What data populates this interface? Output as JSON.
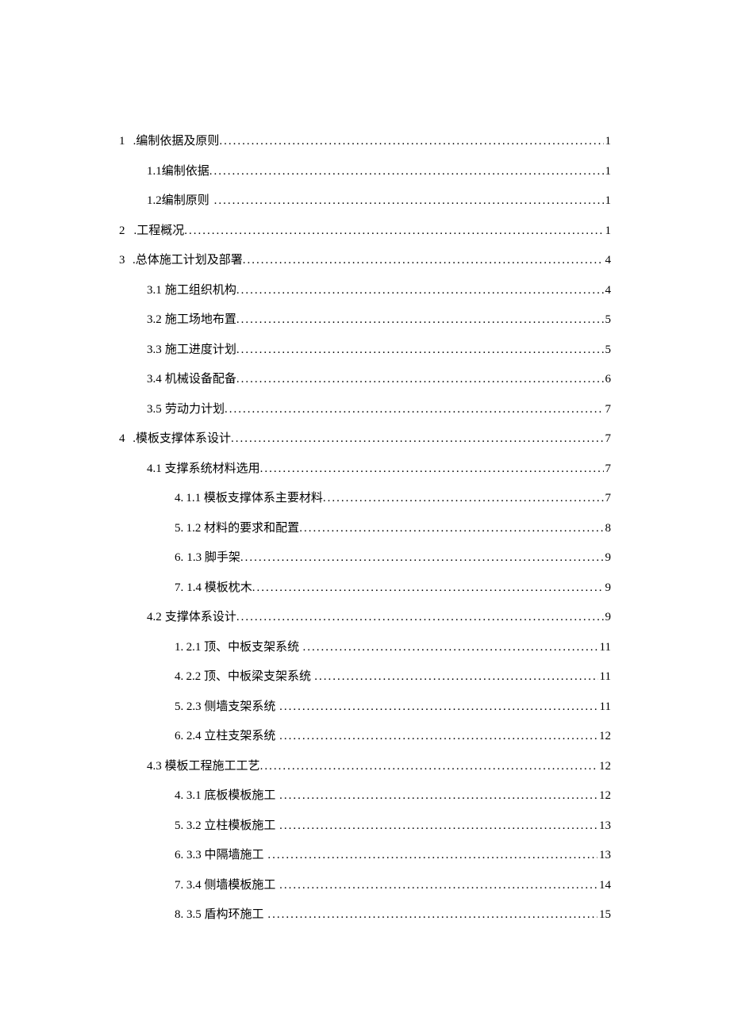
{
  "toc": [
    {
      "level": 1,
      "num": "1",
      "sep": "wide",
      "title": ".编制依据及原则",
      "page": "1"
    },
    {
      "level": 2,
      "num": "1.1",
      "sep": "none",
      "title": "编制依据",
      "page": "1"
    },
    {
      "level": 2,
      "num": "1.2",
      "sep": "none",
      "title": "编制原则",
      "titleGap": true,
      "page": "1"
    },
    {
      "level": 1,
      "num": "2",
      "sep": "wide",
      "title": ".工程概况",
      "page": "1"
    },
    {
      "level": 1,
      "num": "3",
      "sep": "wide",
      "title": ".总体施工计划及部署",
      "page": "4"
    },
    {
      "level": 2,
      "num": "3.1",
      "sep": "narrow",
      "title": " 施工组织机构",
      "page": "4"
    },
    {
      "level": 2,
      "num": "3.2",
      "sep": "narrow",
      "title": " 施工场地布置",
      "page": "5"
    },
    {
      "level": 2,
      "num": "3.3",
      "sep": "narrow",
      "title": " 施工进度计划",
      "page": "5"
    },
    {
      "level": 2,
      "num": "3.4",
      "sep": "narrow",
      "title": " 机械设备配备",
      "page": "6"
    },
    {
      "level": 2,
      "num": "3.5",
      "sep": "narrow",
      "title": " 劳动力计划",
      "page": "7"
    },
    {
      "level": 1,
      "num": "4",
      "sep": "wide",
      "title": ".模板支撑体系设计",
      "page": "7"
    },
    {
      "level": 2,
      "num": "4.1",
      "sep": "narrow",
      "title": " 支撑系统材料选用",
      "page": "7"
    },
    {
      "level": 3,
      "num": "4.",
      "sep": "narrow",
      "title": " 1.1 模板支撑体系主要材料",
      "page": "7"
    },
    {
      "level": 3,
      "num": "5.",
      "sep": "narrow",
      "title": " 1.2 材料的要求和配置",
      "page": "8"
    },
    {
      "level": 3,
      "num": "6.",
      "sep": "narrow",
      "title": " 1.3 脚手架",
      "page": "9"
    },
    {
      "level": 3,
      "num": "7.",
      "sep": "narrow",
      "title": " 1.4 模板枕木",
      "page": "9"
    },
    {
      "level": 2,
      "num": "4.2",
      "sep": "narrow",
      "title": " 支撑体系设计",
      "page": "9"
    },
    {
      "level": 3,
      "num": "1.",
      "sep": "narrow",
      "title": " 2.1 顶、中板支架系统",
      "titleGap": true,
      "page": "11"
    },
    {
      "level": 3,
      "num": "4.",
      "sep": "narrow",
      "title": " 2.2 顶、中板梁支架系统",
      "titleGap": true,
      "page": "11"
    },
    {
      "level": 3,
      "num": "5.",
      "sep": "narrow",
      "title": " 2.3 侧墙支架系统",
      "titleGap": true,
      "page": "11"
    },
    {
      "level": 3,
      "num": "6.",
      "sep": "narrow",
      "title": " 2.4 立柱支架系统",
      "titleGap": true,
      "page": "12"
    },
    {
      "level": 2,
      "num": "4.3",
      "sep": "narrow",
      "title": " 模板工程施工工艺",
      "page": "12"
    },
    {
      "level": 3,
      "num": "4.",
      "sep": "narrow",
      "title": " 3.1 底板模板施工",
      "titleGap": true,
      "page": "12"
    },
    {
      "level": 3,
      "num": "5.",
      "sep": "narrow",
      "title": " 3.2 立柱模板施工",
      "titleGap": true,
      "page": "13"
    },
    {
      "level": 3,
      "num": "6.",
      "sep": "narrow",
      "title": " 3.3 中隔墙施工",
      "titleGap": true,
      "page": "13"
    },
    {
      "level": 3,
      "num": "7.",
      "sep": "narrow",
      "title": " 3.4 侧墙模板施工",
      "titleGap": true,
      "page": "14"
    },
    {
      "level": 3,
      "num": "8.",
      "sep": "narrow",
      "title": " 3.5 盾构环施工",
      "titleGap": true,
      "page": "15"
    }
  ]
}
